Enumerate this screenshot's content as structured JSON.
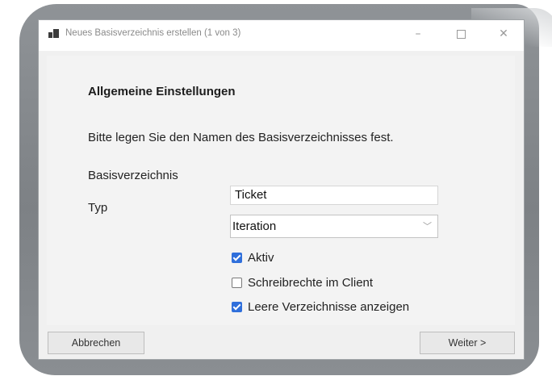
{
  "window": {
    "title": "Neues Basisverzeichnis erstellen (1 von 3)",
    "controls": {
      "minimize": "–",
      "close": "✕"
    }
  },
  "form": {
    "heading": "Allgemeine Einstellungen",
    "description": "Bitte legen Sie den Namen des Basisverzeichnisses fest.",
    "name_label": "Basisverzeichnis",
    "name_value": "Ticket",
    "type_label": "Typ",
    "type_value": "Iteration",
    "checkboxes": [
      {
        "label": "Aktiv",
        "checked": true
      },
      {
        "label": "Schreibrechte im Client",
        "checked": false
      },
      {
        "label": "Leere Verzeichnisse anzeigen",
        "checked": true
      }
    ]
  },
  "buttons": {
    "cancel": "Abbrechen",
    "next": "Weiter >"
  },
  "colors": {
    "checkbox_accent": "#2f6fdb",
    "frame": "#85898d"
  },
  "icons": {
    "app": "app-window-icon",
    "dropdown": "chevron-down-icon"
  }
}
